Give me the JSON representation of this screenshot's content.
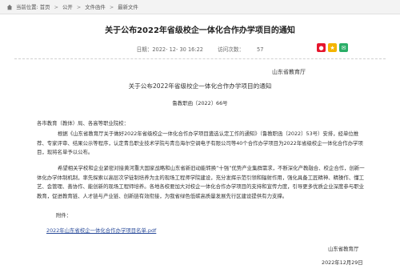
{
  "breadcrumb": {
    "prefix": "当前位置:",
    "items": [
      "首页",
      "公开",
      "文件函件",
      "最新文件"
    ]
  },
  "article": {
    "title": "关于公布2022年省级校企一体化合作办学项目的通知",
    "date_label": "日期：2022- 12- 30 16:22",
    "views_label": "访问次数：",
    "views": "57"
  },
  "share": {
    "icons": [
      "weibo-icon",
      "qzone-icon",
      "wechat-icon"
    ]
  },
  "document": {
    "issuer_top": "山东省教育厅",
    "title": "关于公布2022年省级校企一体化合作办学项目的通知",
    "doc_number": "鲁教职函〔2022〕66号",
    "addressee": "各市教育（教体）局、各高等职业院校：",
    "paragraph1": "根据《山东省教育厅关于做好2022年省级校企一体化合作办学项目遴选认定工作的通知》（鲁教职函〔2022〕53号）安排，经单位推荐、专家评审、结果公示等程序，认定青岛职业技术学院与青岛海尔空调电子有限公司等40个合作办学项目为2022年省级校企一体化合作办学项目，现将名单予以公布。",
    "paragraph2": "希望相关学校和企业紧密对接黄河重大国家战略和山东省新旧动能转换“十强”优势产业集群需求，不断深化产教融合、校企合作，创新一体化办学体制机制，率先探索以高层次学徒制培养为主的现场工程师学院建设，充分发挥示范引领和辐射作用，强化具备工匠精神、精操作、懂工艺、会管理、善协作、能创新的现场工程师培养。各地各校要加大对校企一体化合作办学项目的支持和宣传力度，引导更多优质企业深度参与职业教育，促进教育链、人才链与产业链、创新链有效衔接，为我省绿色低碳高质量发展先行区建设提供有力支撑。",
    "attachment_label": "附件：",
    "attachment_link": "2022年山东省校企一体化合作办学项目名单.pdf",
    "issuer_bottom": "山东省教育厅",
    "date": "2022年12月29日"
  },
  "colors": {
    "breadcrumb_bg": "#f3f3f3",
    "link": "#2b4c9b"
  }
}
